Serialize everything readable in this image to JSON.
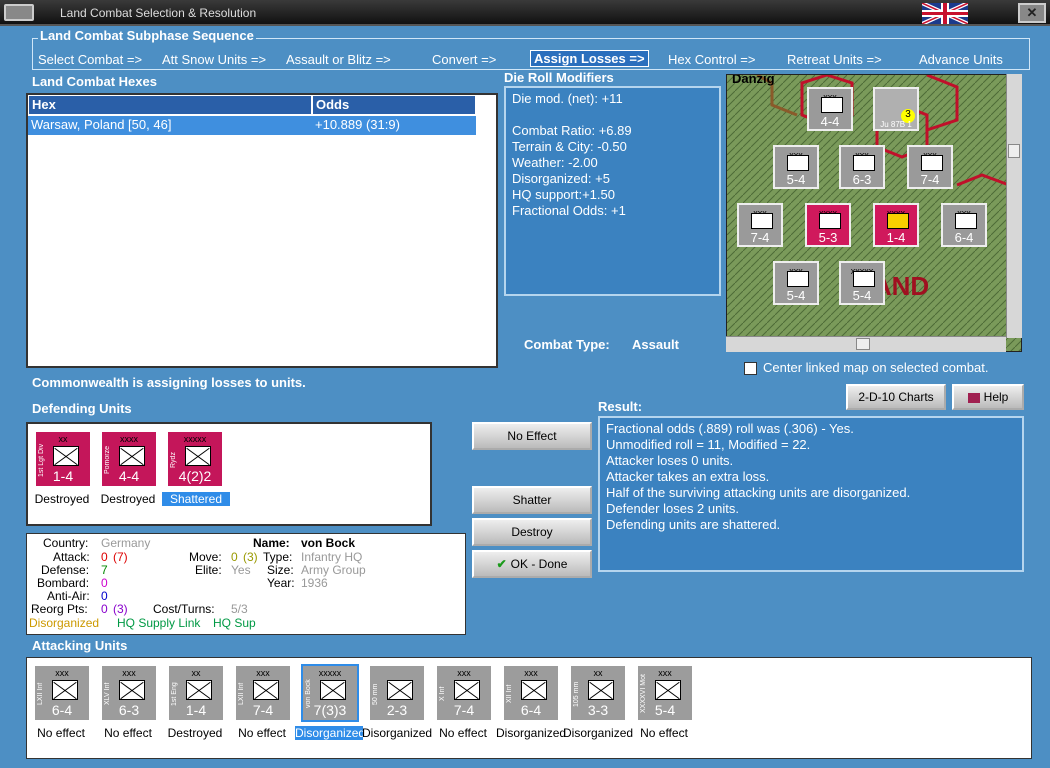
{
  "window": {
    "title": "Land Combat Selection & Resolution"
  },
  "sequence": {
    "title": "Land Combat Subphase Sequence",
    "steps": [
      "Select Combat =>",
      "Att Snow Units =>",
      "Assault or Blitz =>",
      "Convert =>",
      "Assign Losses =>",
      "Hex Control =>",
      "Retreat Units =>",
      "Advance Units"
    ]
  },
  "hexes": {
    "title": "Land Combat Hexes",
    "col_hex": "Hex",
    "col_odds": "Odds",
    "row_hex": "Warsaw, Poland [50, 46]",
    "row_odds": "+10.889 (31:9)"
  },
  "dierolls": {
    "title": "Die Roll Modifiers",
    "lines": [
      "Die mod. (net): +11",
      "",
      "Combat Ratio: +6.89",
      "Terrain & City: -0.50",
      "Weather: -2.00",
      "Disorganized: +5",
      "HQ support:+1.50",
      "Fractional Odds: +1"
    ]
  },
  "map": {
    "center_label": "Center linked map on selected combat.",
    "city_label": "Danzig",
    "land_label": "LAND",
    "units": [
      {
        "size": "xxx",
        "str": "4-4"
      },
      {
        "size": "",
        "str": "Ju 87B 1",
        "badge": "3"
      },
      {
        "size": "xxx",
        "str": "5-4"
      },
      {
        "size": "xxx",
        "str": "6-3"
      },
      {
        "size": "xxx",
        "str": "7-4"
      },
      {
        "size": "xxx",
        "str": "7-4"
      },
      {
        "size": "xxxx",
        "str": "5-3"
      },
      {
        "size": "xxxx",
        "str": "1-4"
      },
      {
        "size": "xxx",
        "str": "6-4"
      },
      {
        "size": "xxx",
        "str": "5-4"
      },
      {
        "size": "xxxxx",
        "str": "5-4"
      }
    ]
  },
  "combat_type": {
    "label": "Combat Type:",
    "value": "Assault"
  },
  "notice": "Commonwealth is assigning losses to units.",
  "defending": {
    "title": "Defending Units",
    "units": [
      {
        "name": "1st Lgt Div",
        "size": "xx",
        "nat": "POL",
        "str": "1-4",
        "status": "Destroyed"
      },
      {
        "name": "Pomorze",
        "size": "xxxx",
        "nat": "POL",
        "str": "4-4",
        "status": "Destroyed"
      },
      {
        "name": "Rydz",
        "size": "xxxxx",
        "nat": "POL",
        "str": "4(2)2",
        "status": "Shattered"
      }
    ]
  },
  "buttons": {
    "no_effect": "No Effect",
    "shatter": "Shatter",
    "destroy": "Destroy",
    "ok": "OK - Done",
    "charts": "2-D-10 Charts",
    "help": "Help"
  },
  "result": {
    "title": "Result:",
    "lines": [
      "Fractional odds (.889) roll was (.306)  - Yes.",
      "Unmodified roll = 11, Modified = 22.",
      "Attacker loses 0 units.",
      "Attacker takes an extra loss.",
      "Half of the surviving attacking units are disorganized.",
      "Defender loses 2 units.",
      "Defending units are shattered."
    ]
  },
  "info": {
    "country_l": "Country:",
    "country": "Germany",
    "attack_l": "Attack:",
    "attack": "0",
    "attack_x": "(7)",
    "defense_l": "Defense:",
    "defense": "7",
    "bombard_l": "Bombard:",
    "bombard": "0",
    "antiair_l": "Anti-Air:",
    "antiair": "0",
    "reorg_l": "Reorg Pts:",
    "reorg": "0",
    "reorg_x": "(3)",
    "name_l": "Name:",
    "name": "von Bock",
    "move_l": "Move:",
    "move": "0",
    "move_x": "(3)",
    "elite_l": "Elite:",
    "elite": "Yes",
    "type_l": "Type:",
    "type": "Infantry HQ",
    "size_l": "Size:",
    "size": "Army Group",
    "year_l": "Year:",
    "year": "1936",
    "cost_l": "Cost/Turns:",
    "cost": "5/3",
    "flag1": "Disorganized",
    "flag2": "HQ Supply Link",
    "flag3": "HQ Sup"
  },
  "attacking": {
    "title": "Attacking Units",
    "units": [
      {
        "name": "LXII Inf",
        "size": "xxx",
        "str": "6-4",
        "status": "No effect"
      },
      {
        "name": "XLV Inf",
        "size": "xxx",
        "str": "6-3",
        "status": "No effect"
      },
      {
        "name": "1st Eng",
        "size": "xx",
        "str": "1-4",
        "status": "Destroyed"
      },
      {
        "name": "LXII Inf",
        "size": "xxx",
        "str": "7-4",
        "status": "No effect"
      },
      {
        "name": "von Bock",
        "size": "xxxxx",
        "str": "7(3)3",
        "status": "Disorganized"
      },
      {
        "name": "50 mm",
        "size": "",
        "str": "2-3",
        "status": "Disorganized"
      },
      {
        "name": "X Inf",
        "size": "xxx",
        "str": "7-4",
        "status": "No effect"
      },
      {
        "name": "XII Inf",
        "size": "xxx",
        "str": "6-4",
        "status": "Disorganized"
      },
      {
        "name": "105 mm",
        "size": "xx",
        "str": "3-3",
        "status": "Disorganized"
      },
      {
        "name": "XXXXVI Mot",
        "size": "xxx",
        "str": "5-4",
        "status": "No effect"
      }
    ]
  },
  "colors": {
    "bg": "#4d8fc4",
    "panel": "#3b82c0",
    "select": "#3f8fdf",
    "pol": "#c4165a"
  }
}
